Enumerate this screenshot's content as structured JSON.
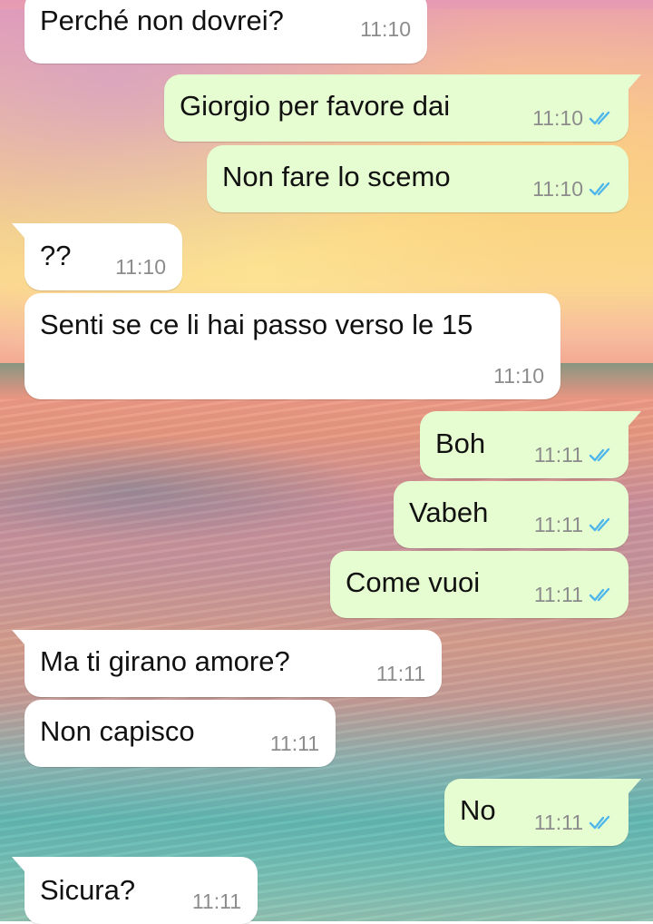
{
  "colors": {
    "incoming_bubble": "#ffffff",
    "outgoing_bubble": "#e6fdd1",
    "timestamp": "#8c8c8c",
    "read_ticks": "#4fb6ec"
  },
  "icons": {
    "read_receipt": "double-check-icon"
  },
  "messages": [
    {
      "direction": "in",
      "text": "Perché non dovrei?",
      "time": "11:10"
    },
    {
      "direction": "out",
      "text": "Giorgio per favore dai",
      "time": "11:10",
      "status": "read"
    },
    {
      "direction": "out",
      "text": "Non fare lo scemo",
      "time": "11:10",
      "status": "read"
    },
    {
      "direction": "in",
      "text": "??",
      "time": "11:10"
    },
    {
      "direction": "in",
      "text": "Senti se ce li hai passo verso le 15",
      "time": "11:10"
    },
    {
      "direction": "out",
      "text": "Boh",
      "time": "11:11",
      "status": "read"
    },
    {
      "direction": "out",
      "text": "Vabeh",
      "time": "11:11",
      "status": "read"
    },
    {
      "direction": "out",
      "text": "Come vuoi",
      "time": "11:11",
      "status": "read"
    },
    {
      "direction": "in",
      "text": "Ma ti girano amore?",
      "time": "11:11"
    },
    {
      "direction": "in",
      "text": "Non capisco",
      "time": "11:11"
    },
    {
      "direction": "out",
      "text": "No",
      "time": "11:11",
      "status": "read"
    },
    {
      "direction": "in",
      "text": "Sicura?",
      "time": "11:11"
    }
  ]
}
